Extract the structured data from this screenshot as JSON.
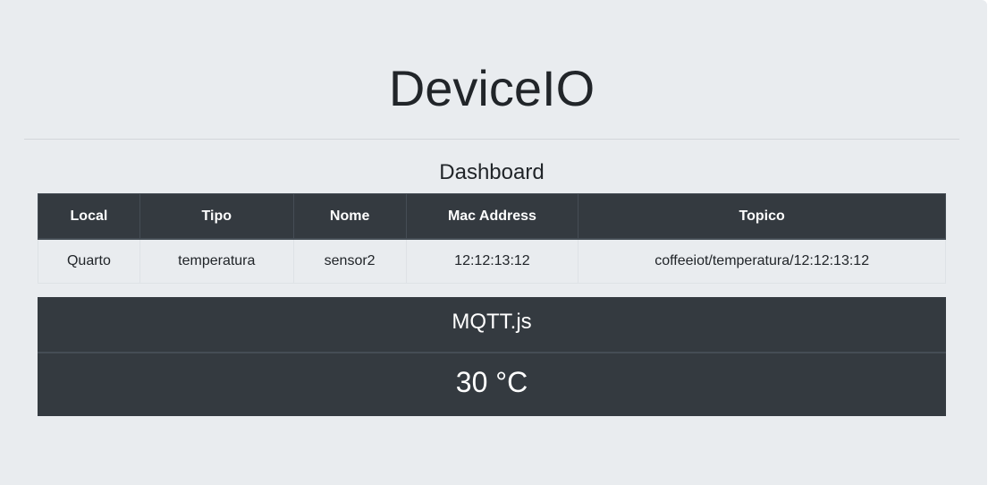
{
  "app": {
    "title": "DeviceIO"
  },
  "dashboard": {
    "title": "Dashboard",
    "table": {
      "columns": [
        "Local",
        "Tipo",
        "Nome",
        "Mac Address",
        "Topico"
      ],
      "rows": [
        [
          "Quarto",
          "temperatura",
          "sensor2",
          "12:12:13:12",
          "coffeeiot/temperatura/12:12:13:12"
        ]
      ]
    }
  },
  "mqtt": {
    "title": "MQTT.js",
    "reading": "30 °C"
  },
  "colors": {
    "background": "#e9ecef",
    "dark": "#343a40",
    "text": "#212529"
  }
}
